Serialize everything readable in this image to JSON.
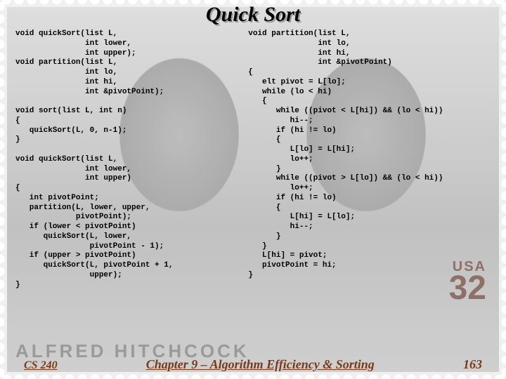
{
  "title": "Quick Sort",
  "bg": {
    "name_text": "ALFRED HITCHCOCK",
    "country": "USA",
    "denom": "32"
  },
  "code": {
    "left": "void quickSort(list L,\n               int lower,\n               int upper);\nvoid partition(list L,\n               int lo,\n               int hi,\n               int &pivotPoint);\n\nvoid sort(list L, int n)\n{\n   quickSort(L, 0, n-1);\n}\n\nvoid quickSort(list L,\n               int lower,\n               int upper)\n{\n   int pivotPoint;\n   partition(L, lower, upper,\n             pivotPoint);\n   if (lower < pivotPoint)\n      quickSort(L, lower,\n                pivotPoint - 1);\n   if (upper > pivotPoint)\n      quickSort(L, pivotPoint + 1,\n                upper);\n}",
    "right": "void partition(list L,\n               int lo,\n               int hi,\n               int &pivotPoint)\n{\n   elt pivot = L[lo];\n   while (lo < hi)\n   {\n      while ((pivot < L[hi]) && (lo < hi))\n         hi--;\n      if (hi != lo)\n      {\n         L[lo] = L[hi];\n         lo++;\n      }\n      while ((pivot > L[lo]) && (lo < hi))\n         lo++;\n      if (hi != lo)\n      {\n         L[hi] = L[lo];\n         hi--;\n      }\n   }\n   L[hi] = pivot;\n   pivotPoint = hi;\n}"
  },
  "footer": {
    "course": "CS 240",
    "chapter": "Chapter 9 – Algorithm Efficiency & Sorting",
    "page": "163"
  }
}
